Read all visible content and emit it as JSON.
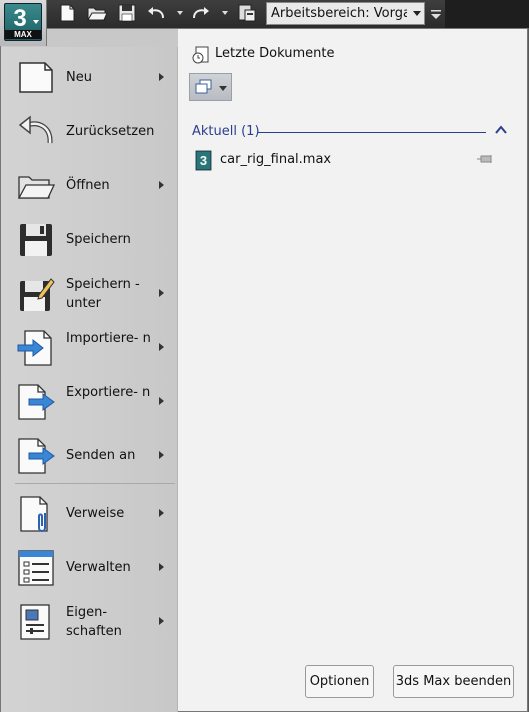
{
  "toolbar": {
    "app_logo_text": "3",
    "app_logo_sub": "MAX",
    "workspace_placeholder": "Arbeitsbereich: Vorgabe",
    "icons": [
      "new-icon",
      "open-icon",
      "save-icon",
      "undo-icon",
      "redo-icon",
      "project-icon",
      "overflow-icon"
    ]
  },
  "menu": {
    "items": [
      {
        "label": "Neu",
        "icon": "new-document-icon",
        "submenu": true
      },
      {
        "label": "Zurücksetzen",
        "icon": "reset-icon",
        "submenu": false
      },
      {
        "label": "Öffnen",
        "icon": "open-folder-icon",
        "submenu": true
      },
      {
        "label": "Speichern",
        "icon": "save-icon",
        "submenu": false
      },
      {
        "label": "Speichern - unter",
        "icon": "save-as-icon",
        "submenu": true
      },
      {
        "label": "Importiere- n",
        "icon": "import-icon",
        "submenu": true
      },
      {
        "label": "Exportiere- n",
        "icon": "export-icon",
        "submenu": true
      },
      {
        "label": "Senden an",
        "icon": "send-to-icon",
        "submenu": true
      },
      {
        "label": "Verweise",
        "icon": "references-icon",
        "submenu": true
      },
      {
        "label": "Verwalten",
        "icon": "manage-icon",
        "submenu": true
      },
      {
        "label": "Eigen- schaften",
        "icon": "properties-icon",
        "submenu": true
      }
    ]
  },
  "recent": {
    "title": "Letzte Dokumente",
    "group_label": "Aktuell (1)",
    "documents": [
      {
        "name": "car_rig_final.max"
      }
    ]
  },
  "footer": {
    "options_label": "Optionen",
    "exit_label": "3ds Max beenden"
  },
  "colors": {
    "accent": "#2b3f8c",
    "app_logo": "#2a7578"
  }
}
